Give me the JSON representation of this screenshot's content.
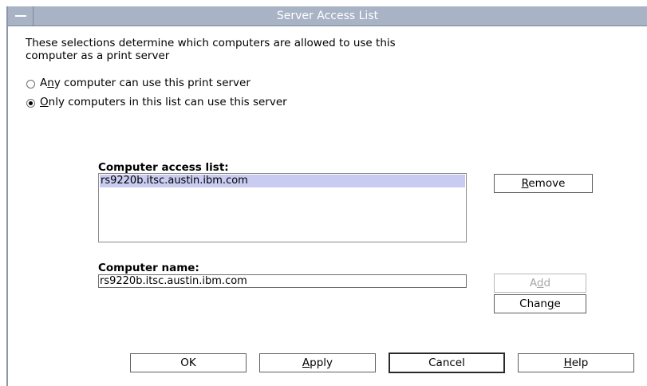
{
  "window": {
    "title": "Server Access List"
  },
  "description": {
    "line1": "These selections determine which computers are allowed to use this",
    "line2": "computer as a print server"
  },
  "access_mode": {
    "options": [
      {
        "pre": "A",
        "mnemonic": "n",
        "post": "y computer can use this print server",
        "selected": false
      },
      {
        "pre": "",
        "mnemonic": "O",
        "post": "nly computers in this list can use this server",
        "selected": true
      }
    ]
  },
  "access_list": {
    "label": "Computer access list:",
    "items": [
      "rs9220b.itsc.austin.ibm.com"
    ],
    "selected_index": 0
  },
  "computer_name": {
    "label": "Computer name:",
    "value": "rs9220b.itsc.austin.ibm.com"
  },
  "side_buttons": {
    "remove": {
      "mnemonic": "R",
      "rest": "emove"
    },
    "add": {
      "pre": "A",
      "mnemonic": "d",
      "post": "d",
      "enabled": false
    },
    "change": {
      "pre": "Chan",
      "mnemonic": "g",
      "post": "e"
    }
  },
  "footer_buttons": {
    "ok": "OK",
    "apply": {
      "mnemonic": "A",
      "rest": "pply"
    },
    "cancel": "Cancel",
    "help": {
      "mnemonic": "H",
      "rest": "elp"
    }
  },
  "colors": {
    "titlebar": "#a9b3c6",
    "selection": "#c9cbf0"
  }
}
